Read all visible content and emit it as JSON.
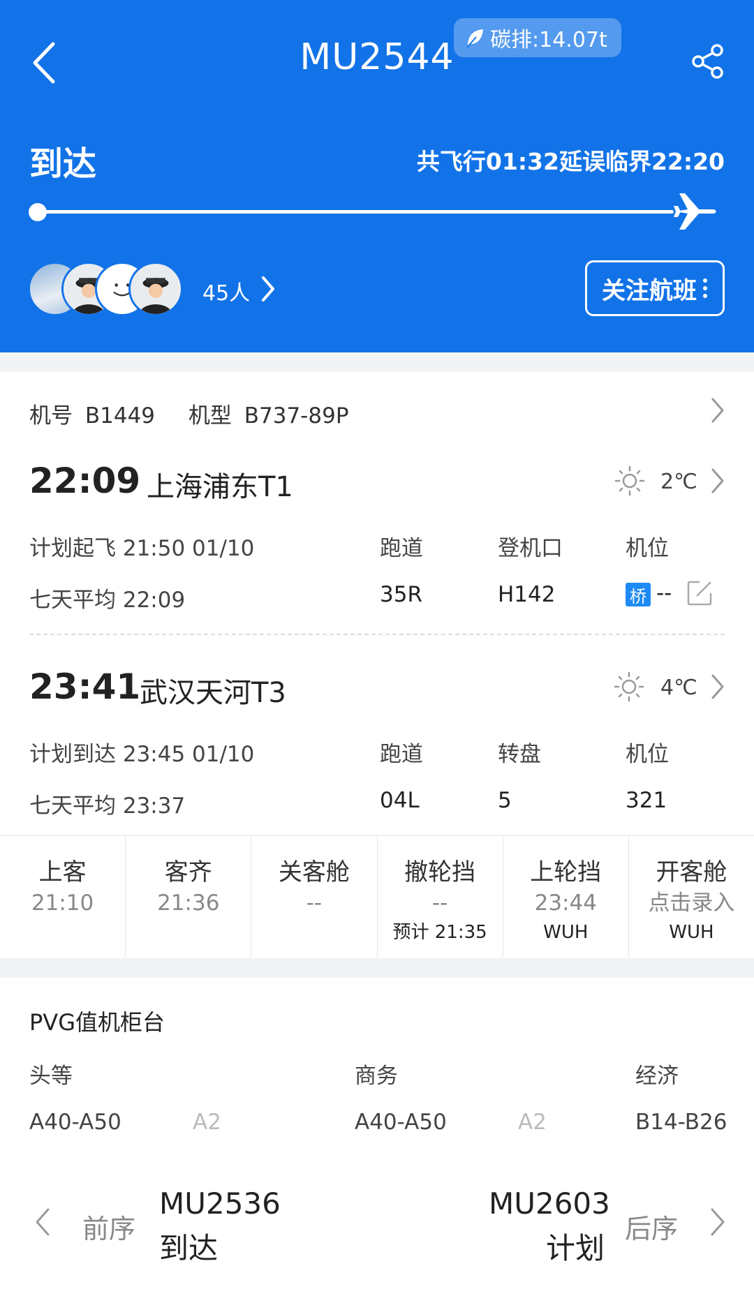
{
  "header": {
    "flight_no": "MU2544",
    "carbon": "碳排:14.07t",
    "status": "到达",
    "flight_info": "共飞行01:32延误临界22:20",
    "passenger_count": "45人",
    "follow_label": "关注航班"
  },
  "aircraft": {
    "reg_label": "机号",
    "reg": "B1449",
    "type_label": "机型",
    "type": "B737-89P"
  },
  "departure": {
    "time": "22:09",
    "airport": "上海浦东T1",
    "temp": "2℃",
    "planned": "计划起飞 21:50 01/10",
    "avg": "七天平均 22:09",
    "col1_label": "跑道",
    "col1_value": "35R",
    "col2_label": "登机口",
    "col2_value": "H142",
    "col3_label": "机位",
    "col3_value": "--",
    "bridge_badge": "桥"
  },
  "arrival": {
    "time": "23:41",
    "airport": "武汉天河T3",
    "temp": "4℃",
    "planned": "计划到达 23:45 01/10",
    "avg": "七天平均 23:37",
    "col1_label": "跑道",
    "col1_value": "04L",
    "col2_label": "转盘",
    "col2_value": "5",
    "col3_label": "机位",
    "col3_value": "321"
  },
  "milestones": [
    {
      "label": "上客",
      "value": "21:10",
      "sub": ""
    },
    {
      "label": "客齐",
      "value": "21:36",
      "sub": ""
    },
    {
      "label": "关客舱",
      "value": "--",
      "sub": ""
    },
    {
      "label": "撤轮挡",
      "value": "--",
      "sub": "预计 21:35"
    },
    {
      "label": "上轮挡",
      "value": "23:44",
      "sub": "WUH"
    },
    {
      "label": "开客舱",
      "value": "点击录入",
      "sub": "WUH"
    }
  ],
  "checkin": {
    "title": "PVG值机柜台",
    "classes": [
      "头等",
      "商务",
      "经济"
    ],
    "first_a": "A40-A50",
    "first_b": "A2",
    "business_a": "A40-A50",
    "business_b": "A2",
    "economy": "B14-B26"
  },
  "nav": {
    "prev_label": "前序",
    "prev_flight": "MU2536",
    "prev_status": "到达",
    "next_label": "后序",
    "next_flight": "MU2603",
    "next_status": "计划"
  }
}
